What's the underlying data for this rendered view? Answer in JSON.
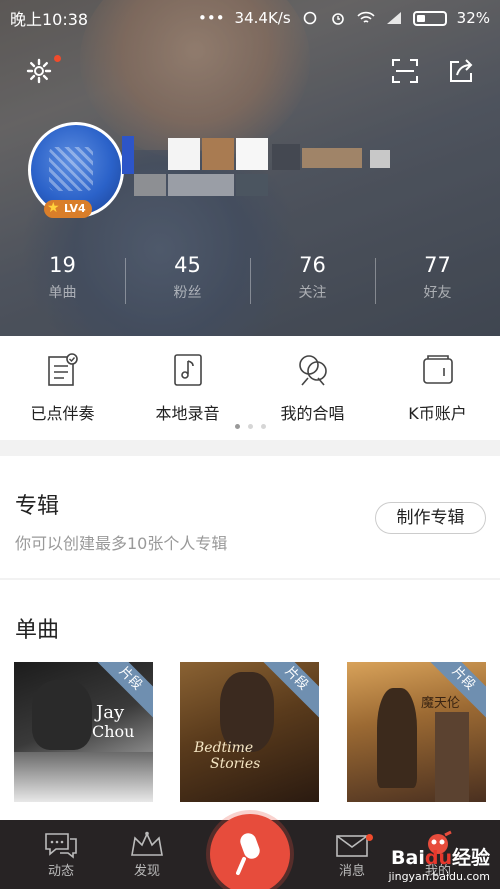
{
  "status_bar": {
    "time": "晚上10:38",
    "network_speed": "34.4K/s",
    "battery": "32%"
  },
  "profile": {
    "level_badge": "LV4",
    "stats": [
      {
        "value": "19",
        "label": "单曲"
      },
      {
        "value": "45",
        "label": "粉丝"
      },
      {
        "value": "76",
        "label": "关注"
      },
      {
        "value": "77",
        "label": "好友"
      }
    ]
  },
  "quick_menu": [
    {
      "label": "已点伴奏",
      "icon": "accompaniment-list-icon"
    },
    {
      "label": "本地录音",
      "icon": "local-recording-icon"
    },
    {
      "label": "我的合唱",
      "icon": "chorus-icon"
    },
    {
      "label": "K币账户",
      "icon": "wallet-icon"
    }
  ],
  "album": {
    "title": "专辑",
    "subtitle": "你可以创建最多10张个人专辑",
    "button": "制作专辑"
  },
  "singles": {
    "title": "单曲",
    "cover_tag": "片段",
    "covers": [
      {
        "text1": "Jay",
        "text2": "Chou"
      },
      {
        "text1": "Bedtime",
        "text2": "Stories"
      },
      {
        "text1": "魔天伦",
        "text2": ""
      }
    ]
  },
  "bottom_nav": [
    {
      "label": "动态",
      "icon": "chat-bubble-icon"
    },
    {
      "label": "发现",
      "icon": "crown-icon"
    },
    {
      "label": "",
      "icon": "microphone-icon"
    },
    {
      "label": "消息",
      "icon": "envelope-icon"
    },
    {
      "label": "我的",
      "icon": "profile-icon"
    }
  ],
  "watermark": {
    "brand": "Bai",
    "brand_mid": "du",
    "brand_suffix": "经验",
    "url": "jingyan.baidu.com"
  },
  "colors": {
    "accent": "#e74c3c",
    "badge": "#d97e2a",
    "tag": "#6f8fb0"
  }
}
